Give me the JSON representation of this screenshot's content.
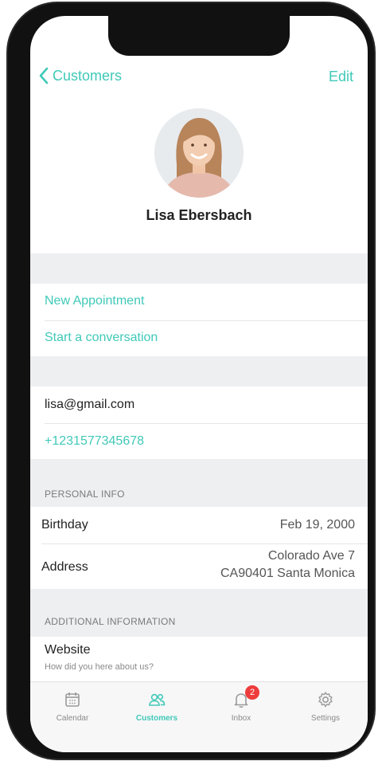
{
  "nav": {
    "back_label": "Customers",
    "edit_label": "Edit"
  },
  "profile": {
    "name": "Lisa Ebersbach"
  },
  "actions": {
    "new_appointment": "New Appointment",
    "start_conversation": "Start a conversation"
  },
  "contact": {
    "email": "lisa@gmail.com",
    "phone": "+1231577345678"
  },
  "personal_info": {
    "header": "PERSONAL INFO",
    "birthday_label": "Birthday",
    "birthday_value": "Feb 19, 2000",
    "address_label": "Address",
    "address_line1": "Colorado Ave 7",
    "address_line2": "CA90401 Santa Monica"
  },
  "additional_info": {
    "header": "ADDITIONAL INFORMATION",
    "website_label": "Website",
    "website_hint": "How did you here about us?"
  },
  "tabs": [
    {
      "label": "Calendar",
      "icon": "calendar-icon"
    },
    {
      "label": "Customers",
      "icon": "customers-icon"
    },
    {
      "label": "Inbox",
      "icon": "bell-icon",
      "badge": "2"
    },
    {
      "label": "Settings",
      "icon": "gear-icon"
    }
  ],
  "colors": {
    "accent": "#40c9b8",
    "badge": "#ee3b3b",
    "section_bg": "#eeeff1"
  }
}
